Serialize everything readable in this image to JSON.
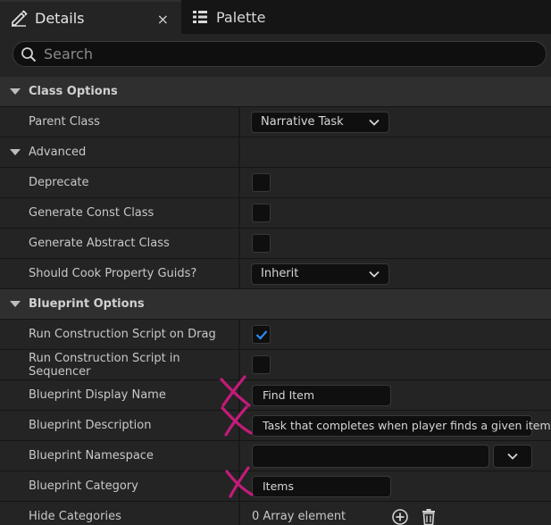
{
  "tabs": [
    {
      "label": "Details",
      "icon": "pencil-icon",
      "active": true
    },
    {
      "label": "Palette",
      "icon": "palette-list-icon",
      "active": false
    }
  ],
  "close_icon": "×",
  "search": {
    "placeholder": "Search"
  },
  "sections": {
    "class_options": {
      "label": "Class Options",
      "parent_class": {
        "label": "Parent Class",
        "value": "Narrative Task"
      }
    },
    "advanced": {
      "label": "Advanced",
      "deprecate": {
        "label": "Deprecate",
        "checked": false
      },
      "generate_const_class": {
        "label": "Generate Const Class",
        "checked": false
      },
      "generate_abstract_class": {
        "label": "Generate Abstract Class",
        "checked": false
      },
      "should_cook_property_guids": {
        "label": "Should Cook Property Guids?",
        "value": "Inherit"
      }
    },
    "blueprint_options": {
      "label": "Blueprint Options",
      "run_construction_script_on_drag": {
        "label": "Run Construction Script on Drag",
        "checked": true
      },
      "run_construction_script_in_sequencer": {
        "label": "Run Construction Script in Sequencer",
        "checked": false
      },
      "blueprint_display_name": {
        "label": "Blueprint Display Name",
        "value": "Find Item"
      },
      "blueprint_description": {
        "label": "Blueprint Description",
        "value": "Task that completes when player finds a given item"
      },
      "blueprint_namespace": {
        "label": "Blueprint Namespace",
        "value": ""
      },
      "blueprint_category": {
        "label": "Blueprint Category",
        "value": "Items"
      },
      "hide_categories": {
        "label": "Hide Categories",
        "value": "0 Array element"
      }
    }
  },
  "colors": {
    "panel": "#242424",
    "category": "#2f2f2f",
    "field": "#0f0f0f",
    "check_accent": "#2a8cf0",
    "annotation": "#c41b7a"
  }
}
